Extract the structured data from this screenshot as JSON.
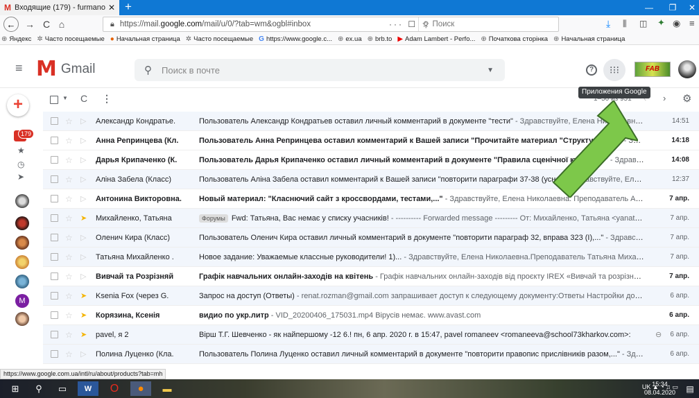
{
  "browser": {
    "tab_title": "Входящие (179) - furmanova",
    "new_tab": "+",
    "url_prefix": "https://mail.",
    "url_domain": "google.com",
    "url_suffix": "/mail/u/0/?tab=wm&ogbl#inbox",
    "url_actions": "··· ☐ ☆",
    "search_placeholder": "Поиск",
    "bookmarks": [
      "Яндекс",
      "Часто посещаемые",
      "Начальная страница",
      "Часто посещаемые",
      "https://www.google.c...",
      "ex.ua",
      "brb.to",
      "Adam Lambert - Perfo...",
      "Початкова сторінка",
      "Начальная страница"
    ],
    "status_link": "https://www.google.com.ua/intl/ru/about/products?tab=mh"
  },
  "gmail": {
    "logo_text": "Gmail",
    "search_placeholder": "Поиск в почте",
    "inbox_badge": "179",
    "tooltip": "Приложения Google",
    "page_count": "1–50 из 951",
    "brand_badge": "FAB",
    "avatar_m_letter": "M"
  },
  "emails": [
    {
      "sender": "Александр Кондратье.",
      "subject": "Пользователь Александр Кондратьев оставил личный комментарий в документе \"тести\"",
      "snippet": " - Здравствуйте, Елена Николаевна. ...",
      "date": "14:51",
      "unread": false,
      "important": false,
      "label": ""
    },
    {
      "sender": "Анна Репринцева (Кл.",
      "subject": "Пользователь Анна Репринцева оставил комментарий к Вашей записи \"Прочитайте материал \"Структура...\"...\"",
      "snippet": " - Здравс...",
      "date": "14:18",
      "unread": true,
      "important": false,
      "label": ""
    },
    {
      "sender": "Дарья Крипаченко (К.",
      "subject": "Пользователь Дарья Крипаченко оставил личный комментарий в документе \"Правила сценічної культури\"",
      "snippet": " - Здравствуйте, Е...",
      "date": "14:08",
      "unread": true,
      "important": false,
      "label": ""
    },
    {
      "sender": "Аліна Забела (Класс)",
      "subject": "Пользователь Аліна Забела оставил комментарий к Вашей записи \"повторити параграфи 37-38 (усно)\"",
      "snippet": " - Здравствуйте, Елена...",
      "date": "12:37",
      "unread": false,
      "important": false,
      "label": ""
    },
    {
      "sender": "Антонина Викторовна.",
      "subject": "Новый материал: \"Класнючий сайт з кроссвордами, тестами,...\"",
      "snippet": " - Здравствуйте, Елена Николаевна. Преподаватель Антонина...",
      "date": "7 апр.",
      "unread": true,
      "important": false,
      "label": ""
    },
    {
      "sender": "Михайленко, Татьяна",
      "subject": "Fwd: Татьяна, Вас немає у списку учасників!",
      "snippet": " - ---------- Forwarded message --------- От: Михайленко, Татьяна <yanata173@...",
      "date": "7 апр.",
      "unread": false,
      "important": true,
      "label": "Форумы"
    },
    {
      "sender": "Оленич Кира (Класс)",
      "subject": "Пользователь Оленич Кира оставил личный комментарий в документе \"повторити параграф 32, вправа 323 (I),...\"",
      "snippet": " - Здравству...",
      "date": "7 апр.",
      "unread": false,
      "important": false,
      "label": ""
    },
    {
      "sender": "Татьяна Михайленко .",
      "subject": "Новое задание: Уважаемые классные руководители! 1)...",
      "snippet": " - Здравствуйте, Елена Николаевна.Преподаватель Татьяна Михайл...",
      "date": "7 апр.",
      "unread": false,
      "important": false,
      "label": ""
    },
    {
      "sender": "Вивчай та Розрізняй",
      "subject": "Графік навчальних онлайн-заходів на квітень",
      "snippet": " - Графік навчальних онлайн-заходів від проєкту IREX «Вивчай та розрізняй: інф...",
      "date": "7 апр.",
      "unread": true,
      "important": false,
      "label": ""
    },
    {
      "sender": "Ksenia Fox (через G.",
      "subject": "Запрос на доступ (Ответы)",
      "snippet": " - renat.rozman@gmail.com запрашивает доступ к следующему документу:Ответы Настройки дост...",
      "date": "6 апр.",
      "unread": false,
      "important": true,
      "label": ""
    },
    {
      "sender": "Корязина, Ксенія",
      "subject": "видио по укр.литр",
      "snippet": " - VID_20200406_175031.mp4 Вірусів немає. www.avast.com",
      "date": "6 апр.",
      "unread": true,
      "important": true,
      "label": ""
    },
    {
      "sender": "pavel, я 2",
      "subject": "Вірш Т.Г. Шевченко - як найпершому -12 6.! пн, 6 апр. 2020 г. в 15:47, pavel romaneev <romaneeva@school73kharkov.com>:",
      "snippet": "",
      "date": "6 апр.",
      "unread": false,
      "important": true,
      "label": "",
      "attachment": true
    },
    {
      "sender": "Полина Луценко (Кла.",
      "subject": "Пользователь Полина Луценко оставил личный комментарий в документе \"повторити правопис прислівників разом,...\"",
      "snippet": " - Здр...",
      "date": "6 апр.",
      "unread": false,
      "important": false,
      "label": ""
    }
  ],
  "taskbar": {
    "lang": "UK",
    "time": "15:34",
    "date": "08.04.2020"
  },
  "colors": {
    "tabstrip": "#0f78d4",
    "gmail_red": "#d93025",
    "arrow_green": "#7dc84a"
  }
}
